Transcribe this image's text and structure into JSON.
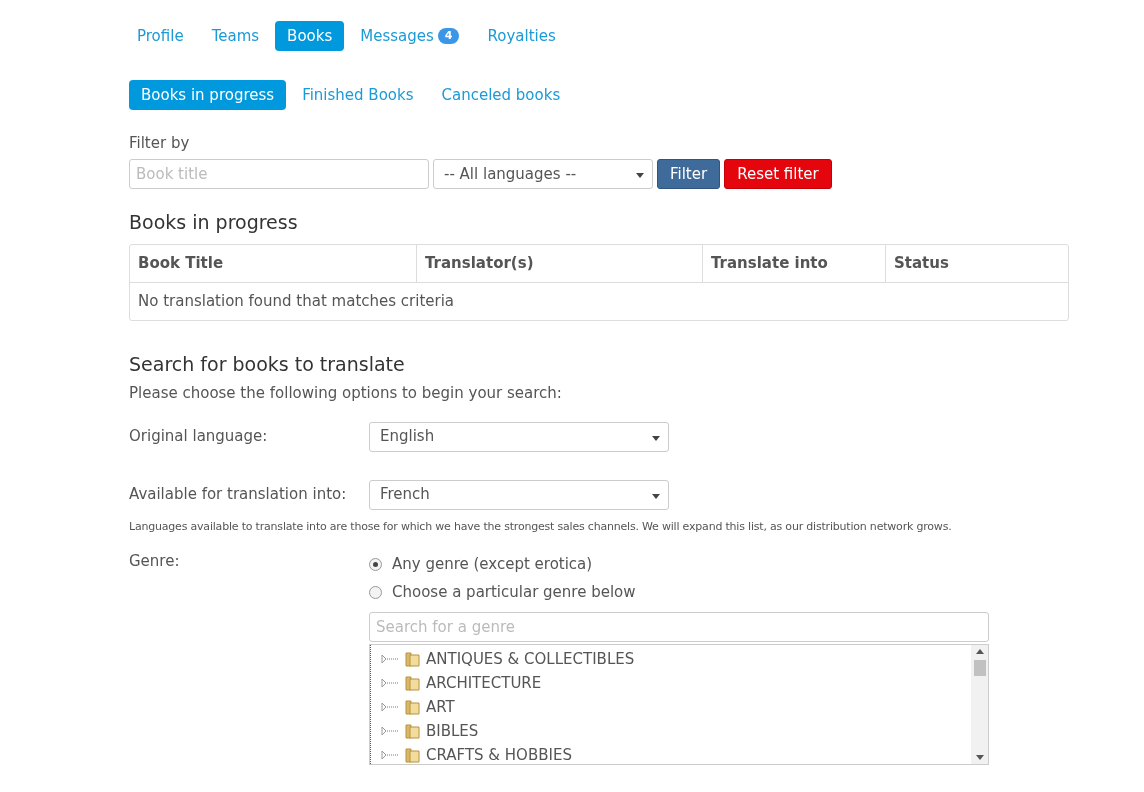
{
  "nav_tabs": [
    {
      "label": "Profile",
      "selected": false
    },
    {
      "label": "Teams",
      "selected": false
    },
    {
      "label": "Books",
      "selected": true
    },
    {
      "label": "Messages",
      "selected": false,
      "badge": "4"
    },
    {
      "label": "Royalties",
      "selected": false
    }
  ],
  "sub_tabs": [
    {
      "label": "Books in progress",
      "selected": true
    },
    {
      "label": "Finished Books",
      "selected": false
    },
    {
      "label": "Canceled books",
      "selected": false
    }
  ],
  "filter": {
    "label": "Filter by",
    "title_field": {
      "placeholder": "Book title"
    },
    "language_select": {
      "value": "-- All languages --"
    },
    "buttons": [
      {
        "label": "Filter",
        "kind": "primary"
      },
      {
        "label": "Reset filter",
        "kind": "danger"
      }
    ]
  },
  "progress_section": {
    "heading": "Books in progress",
    "table": {
      "columns": [
        "Book Title",
        "Translator(s)",
        "Translate into",
        "Status"
      ],
      "empty_message": "No translation found that matches criteria"
    }
  },
  "search_section": {
    "heading": "Search for books to translate",
    "intro": "Please choose the following options to begin your search:",
    "original_language": {
      "label": "Original language:",
      "value": "English"
    },
    "target_language": {
      "label": "Available for translation into:",
      "value": "French"
    },
    "note": "Languages available to translate into are those for which we have the strongest sales channels. We will expand this list, as our distribution network grows.",
    "genre": {
      "label": "Genre:",
      "options": [
        {
          "label": "Any genre (except erotica)",
          "selected": true
        },
        {
          "label": "Choose a particular genre below",
          "selected": false
        }
      ],
      "search": {
        "placeholder": "Search for a genre"
      },
      "tree": [
        {
          "label": "ANTIQUES & COLLECTIBLES",
          "expanded": false
        },
        {
          "label": "ARCHITECTURE",
          "expanded": false
        },
        {
          "label": "ART",
          "expanded": false
        },
        {
          "label": "BIBLES",
          "expanded": false
        },
        {
          "label": "CRAFTS & HOBBIES",
          "expanded": false
        }
      ]
    }
  }
}
